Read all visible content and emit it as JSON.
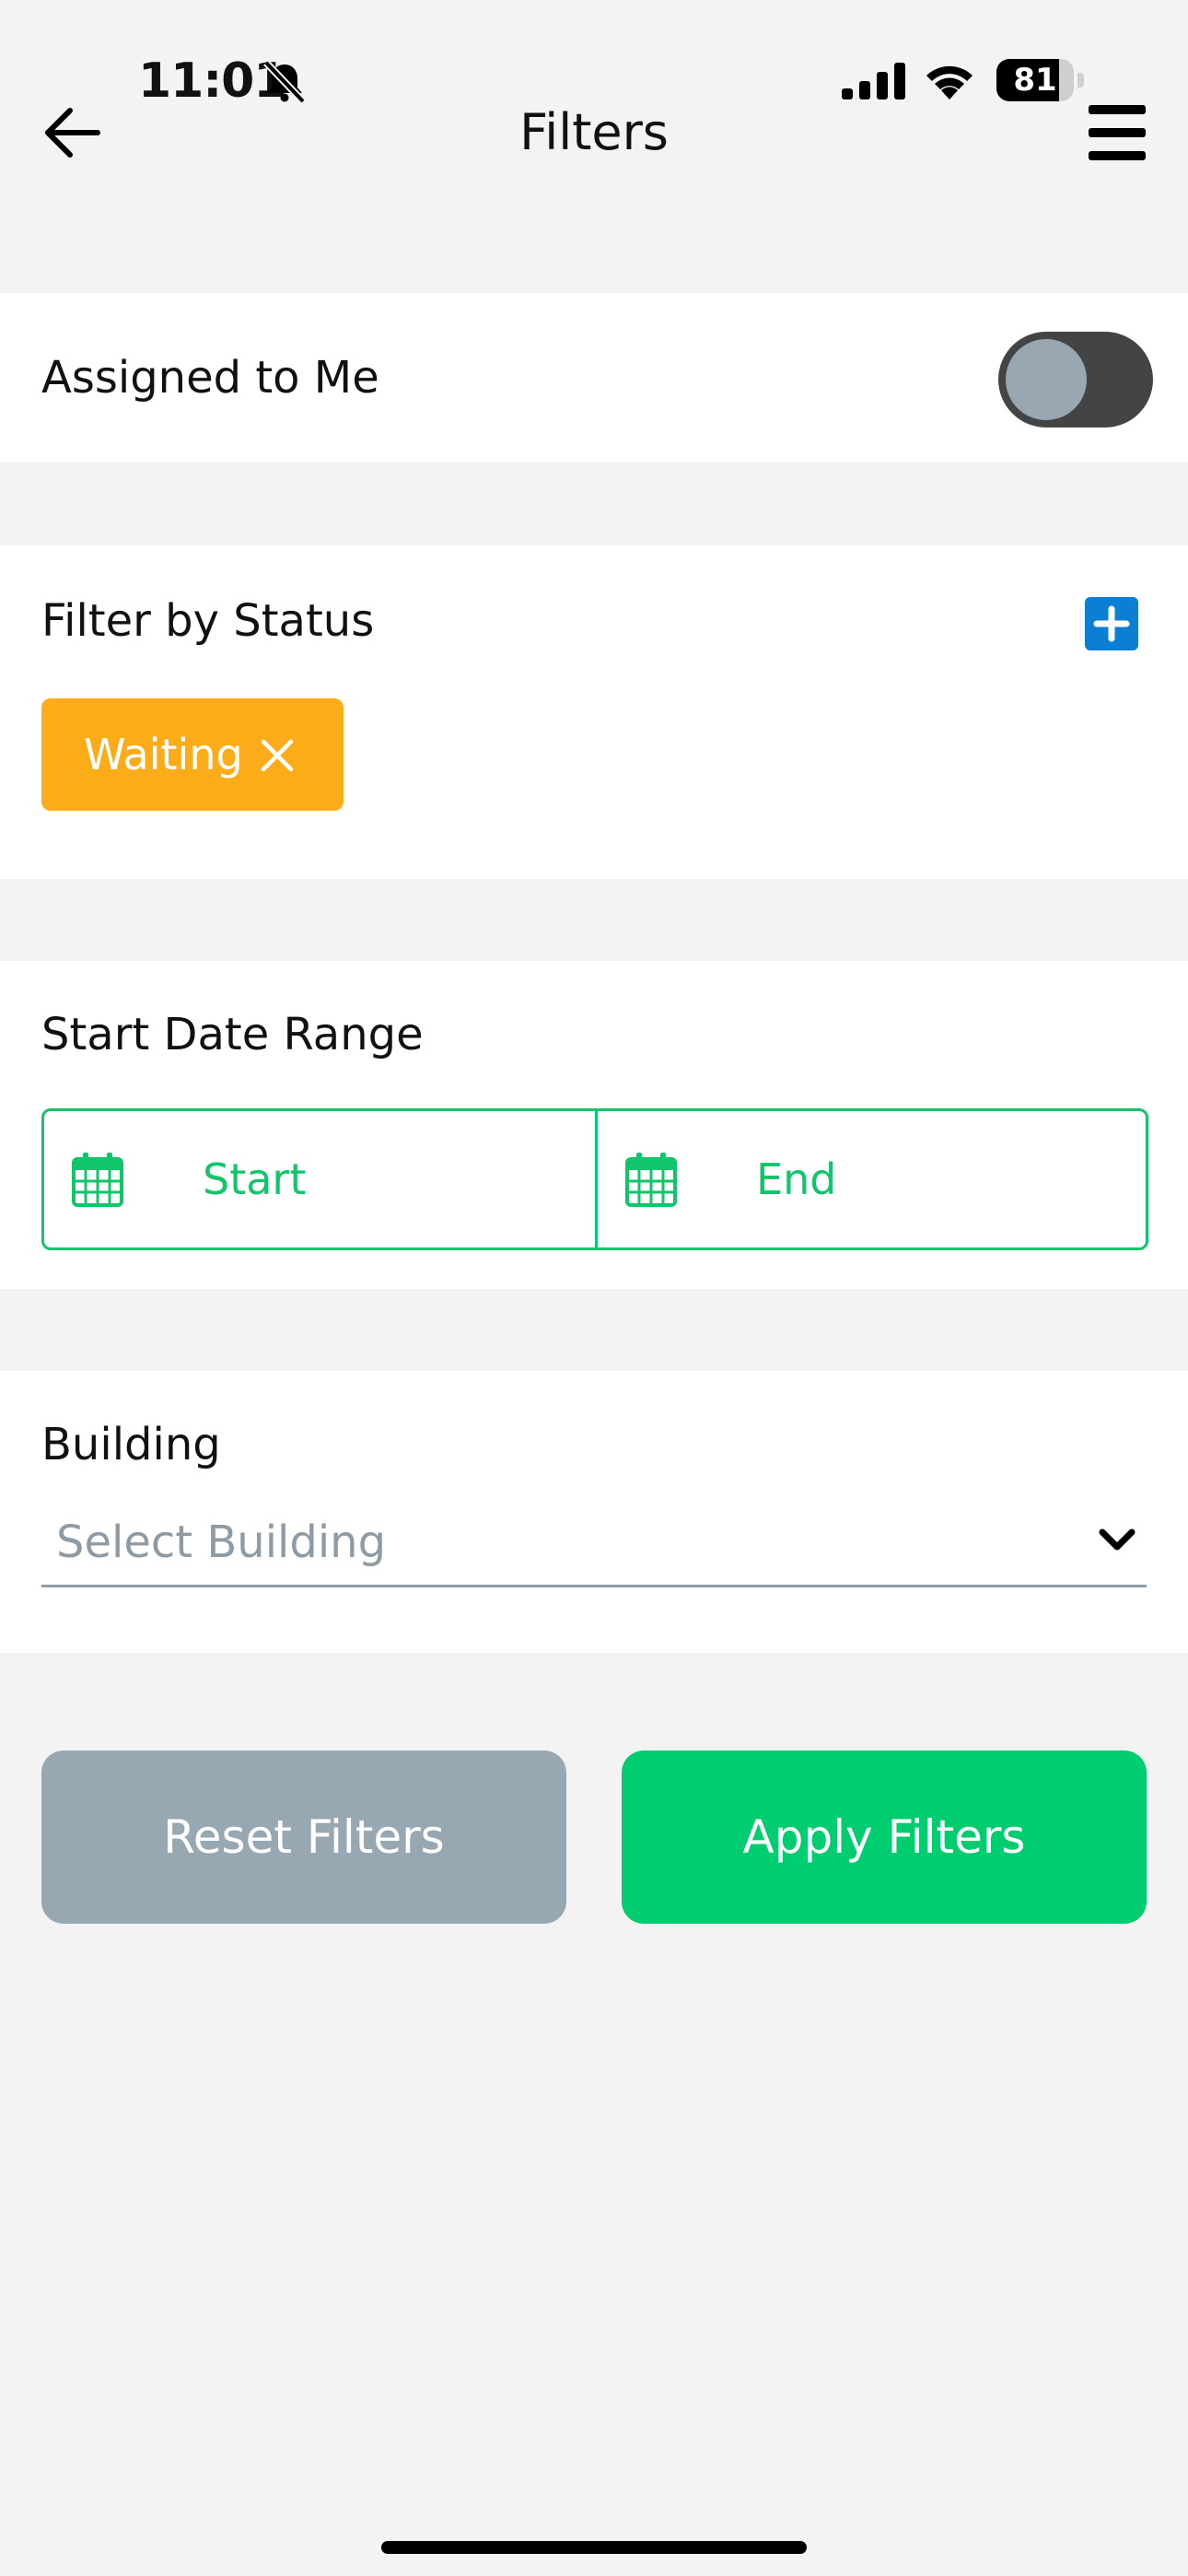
{
  "status_bar": {
    "time": "11:01",
    "battery_level": "81",
    "battery_fraction": 0.81
  },
  "header": {
    "title": "Filters",
    "back_icon": "arrow-left-icon",
    "menu_icon": "hamburger-menu-icon"
  },
  "assigned": {
    "label": "Assigned to Me",
    "toggle_on": false
  },
  "status_filter": {
    "label": "Filter by Status",
    "add_icon": "plus-icon",
    "chips": [
      {
        "label": "Waiting",
        "color": "#fdac19"
      }
    ]
  },
  "date_range": {
    "label": "Start Date Range",
    "start_label": "Start",
    "end_label": "End",
    "icon": "calendar-icon"
  },
  "building": {
    "label": "Building",
    "placeholder": "Select Building"
  },
  "actions": {
    "reset_label": "Reset Filters",
    "apply_label": "Apply Filters"
  },
  "colors": {
    "accent_green": "#10c56a",
    "apply_green": "#00cc70",
    "reset_gray": "#98a8b3",
    "chip_orange": "#fdac19",
    "add_blue": "#0a7fd3"
  }
}
